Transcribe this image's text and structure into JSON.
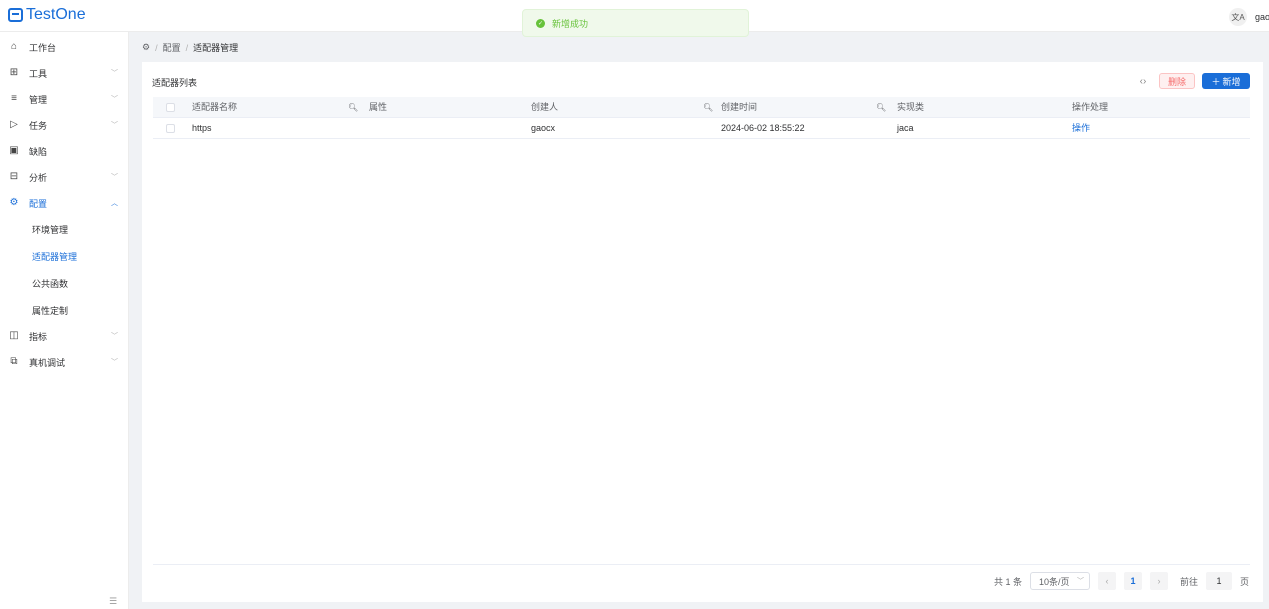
{
  "app": {
    "logo_text": "TestOne",
    "user_name": "gaocx",
    "translate_icon": "translate-icon"
  },
  "toast": {
    "text": "新增成功",
    "icon": "check-circle-icon",
    "color": "#67c23a"
  },
  "sidebar": {
    "items": [
      {
        "label": "工作台",
        "icon": "home-icon"
      },
      {
        "label": "工具",
        "icon": "grid-icon"
      },
      {
        "label": "管理",
        "icon": "list-icon"
      },
      {
        "label": "任务",
        "icon": "send-icon"
      },
      {
        "label": "缺陷",
        "icon": "bug-icon"
      },
      {
        "label": "分析",
        "icon": "chart-icon"
      },
      {
        "label": "配置",
        "icon": "gear-icon"
      },
      {
        "label": "指标",
        "icon": "panel-icon"
      },
      {
        "label": "真机调试",
        "icon": "device-icon"
      }
    ],
    "sub_items": [
      {
        "label": "环境管理"
      },
      {
        "label": "适配器管理"
      },
      {
        "label": "公共函数"
      },
      {
        "label": "属性定制"
      }
    ],
    "active_color": "#1a6ed8"
  },
  "breadcrumb": {
    "items": [
      "配置",
      "适配器管理"
    ]
  },
  "card": {
    "title": "适配器列表",
    "delete_label": "删除",
    "add_label": "新增"
  },
  "table": {
    "headers": [
      "适配器名称",
      "属性",
      "创建人",
      "创建时间",
      "实现类",
      "操作处理"
    ],
    "rows": [
      {
        "name": "https",
        "attr": "",
        "creator": "gaocx",
        "created": "2024-06-02 18:55:22",
        "impl": "jaca",
        "action": "操作"
      }
    ]
  },
  "pagination": {
    "total": "共 1 条",
    "page_size": "10条/页",
    "current": "1",
    "goto_label": "前往",
    "goto_value": "1",
    "page_unit": "页"
  }
}
